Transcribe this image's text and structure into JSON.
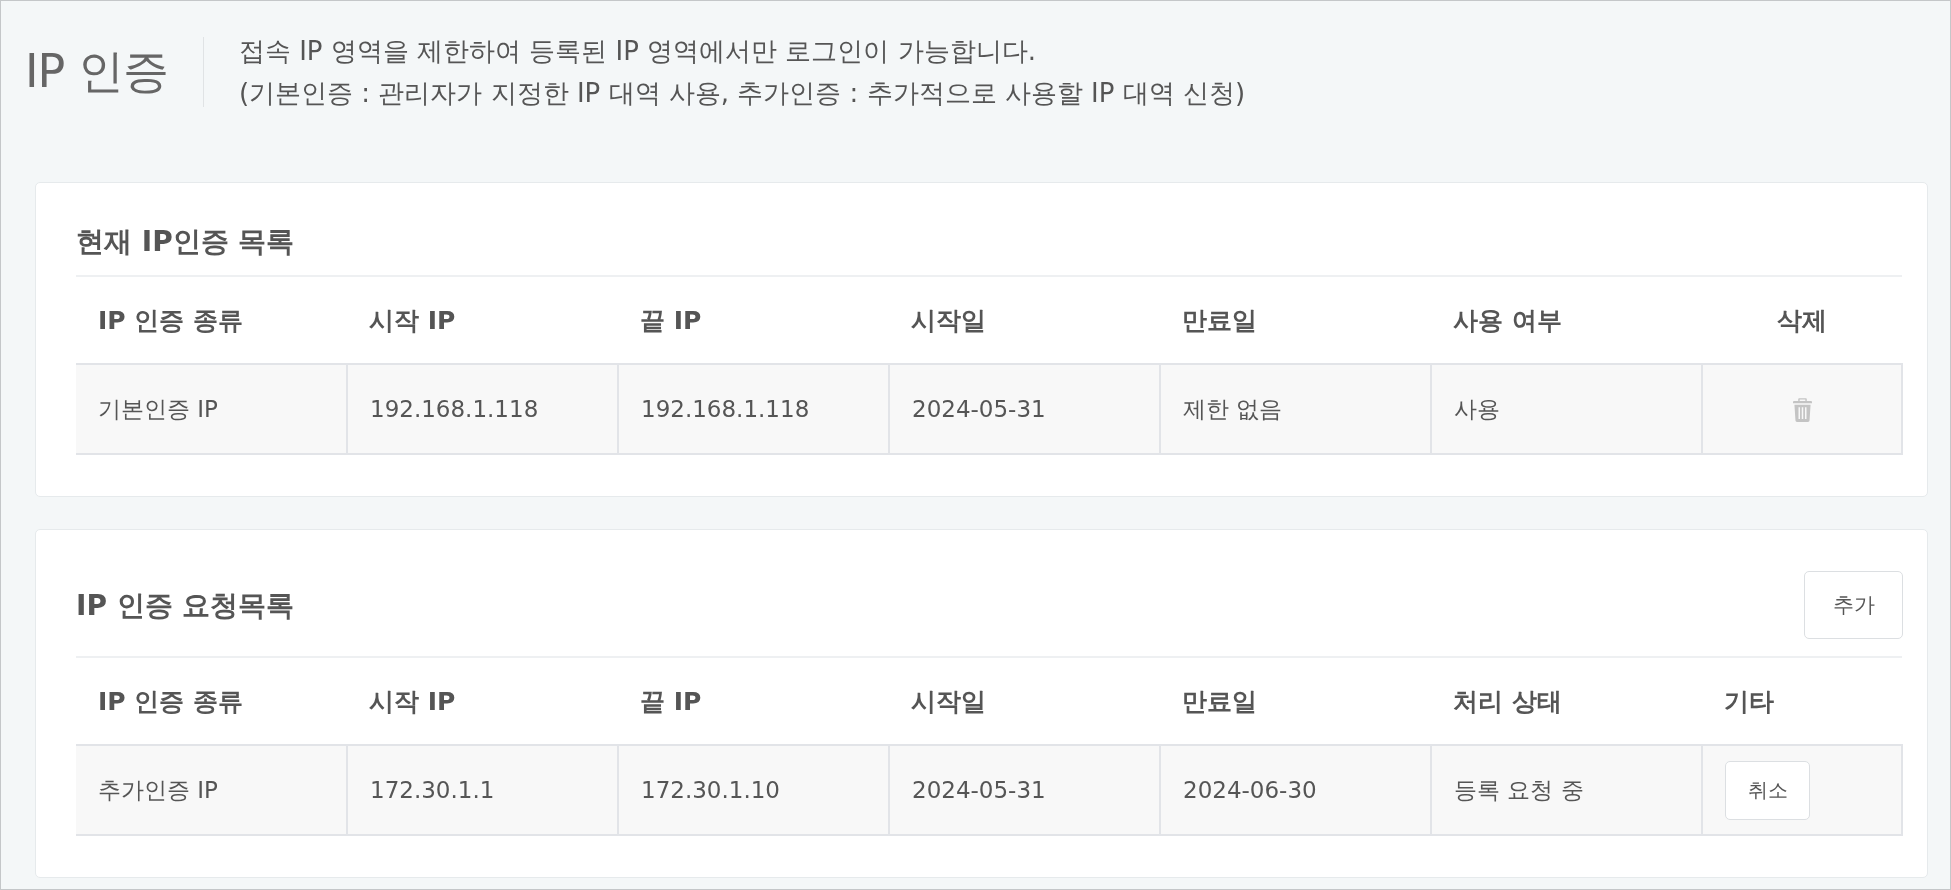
{
  "header": {
    "title": "IP 인증",
    "description": [
      "접속 IP 영역을 제한하여 등록된 IP 영역에서만 로그인이 가능합니다.",
      "(기본인증 : 관리자가 지정한 IP 대역 사용, 추가인증 : 추가적으로 사용할 IP 대역 신청)"
    ]
  },
  "sections": [
    {
      "title": "현재 IP인증 목록",
      "columns": [
        "IP 인증 종류",
        "시작 IP",
        "끝 IP",
        "시작일",
        "만료일",
        "사용 여부",
        "삭제"
      ],
      "rows": [
        {
          "cells": [
            {
              "kind": "text",
              "text": "기본인증 IP"
            },
            {
              "kind": "text",
              "text": "192.168.1.118"
            },
            {
              "kind": "text",
              "text": "192.168.1.118"
            },
            {
              "kind": "text",
              "text": "2024-05-31"
            },
            {
              "kind": "text",
              "text": "제한 없음"
            },
            {
              "kind": "text",
              "text": "사용"
            },
            {
              "kind": "delete_icon"
            }
          ]
        }
      ]
    },
    {
      "title": "IP 인증 요청목록",
      "buttons": [
        "추가"
      ],
      "columns": [
        "IP 인증 종류",
        "시작 IP",
        "끝 IP",
        "시작일",
        "만료일",
        "처리 상태",
        "기타"
      ],
      "rows": [
        {
          "cells": [
            {
              "kind": "text",
              "text": "추가인증 IP"
            },
            {
              "kind": "text",
              "text": "172.30.1.1"
            },
            {
              "kind": "text",
              "text": "172.30.1.10"
            },
            {
              "kind": "text",
              "text": "2024-05-31"
            },
            {
              "kind": "text",
              "text": "2024-06-30"
            },
            {
              "kind": "text",
              "text": "등록 요청 중"
            },
            {
              "kind": "button",
              "text": "취소"
            }
          ]
        }
      ]
    }
  ]
}
